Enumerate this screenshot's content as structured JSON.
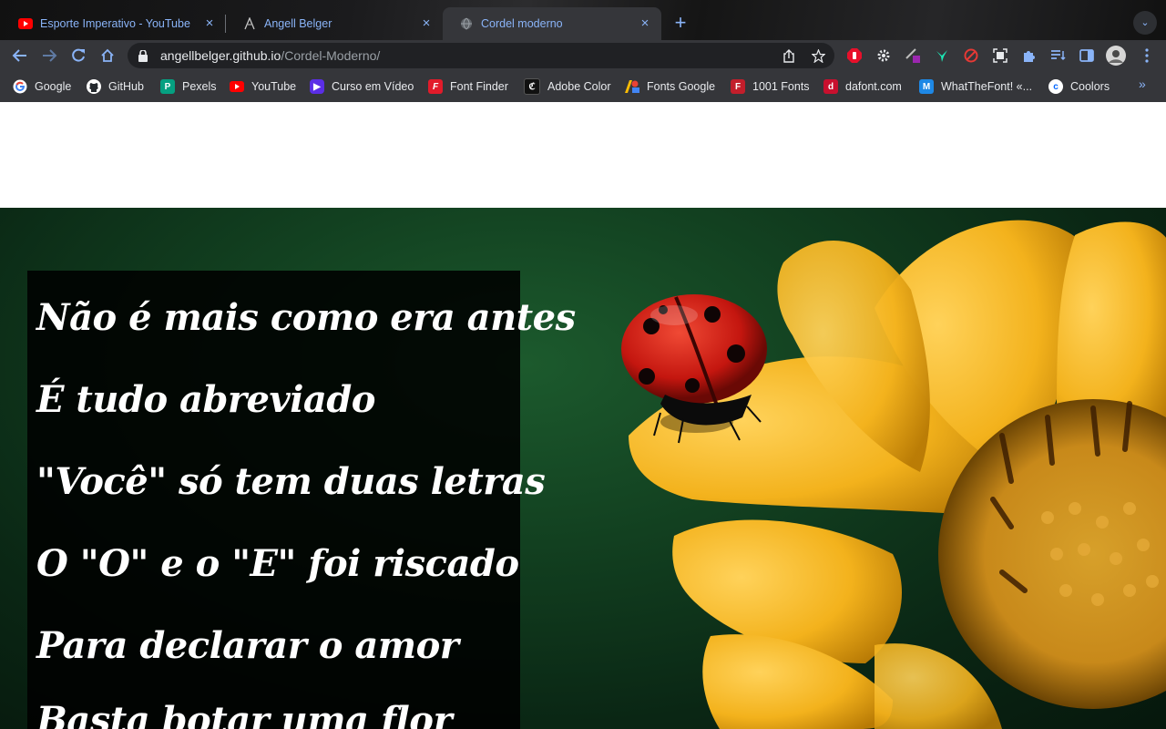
{
  "tabs": [
    {
      "title": "Esporte Imperativo - YouTube",
      "favicon": "youtube-icon"
    },
    {
      "title": "Angell Belger",
      "favicon": "github-pages-icon"
    },
    {
      "title": "Cordel moderno",
      "favicon": "globe-icon"
    }
  ],
  "close_glyph": "×",
  "new_tab_glyph": "+",
  "tab_search_glyph": "⌄",
  "omnibox": {
    "host": "angellbelger.github.io",
    "path": "/Cordel-Moderno/"
  },
  "bookmarks": [
    {
      "label": "Google",
      "icon": "google-icon",
      "color": "#ffffff"
    },
    {
      "label": "GitHub",
      "icon": "github-icon",
      "color": "#ffffff"
    },
    {
      "label": "Pexels",
      "icon": "pexels-icon",
      "color": "#05a081"
    },
    {
      "label": "YouTube",
      "icon": "youtube-icon",
      "color": "#ff0000"
    },
    {
      "label": "Curso em Vídeo",
      "icon": "curso-em-video-icon",
      "color": "#5b2ee6"
    },
    {
      "label": "Font Finder",
      "icon": "font-finder-icon",
      "color": "#e21b2a"
    },
    {
      "label": "Adobe Color",
      "icon": "adobe-color-icon",
      "color": "#111111"
    },
    {
      "label": "Fonts Google",
      "icon": "fonts-google-icon",
      "color": "#4285f4"
    },
    {
      "label": "1001 Fonts",
      "icon": "1001-fonts-icon",
      "color": "#c21e2b"
    },
    {
      "label": "dafont.com",
      "icon": "dafont-icon",
      "color": "#c8102e"
    },
    {
      "label": "WhatTheFont! «...",
      "icon": "whatthefont-icon",
      "color": "#1e88e5"
    },
    {
      "label": "Coolors",
      "icon": "coolors-icon",
      "color": "#0066ff"
    }
  ],
  "bookmarks_more_glyph": "»",
  "poem": {
    "lines": [
      "Não é mais como era antes",
      "É tudo abreviado",
      "\"Você\" só tem duas letras",
      "O \"O\" e o \"E\" foi riscado",
      "Para declarar o amor",
      "Basta botar uma flor"
    ]
  },
  "colors": {
    "accent": "#8ab4f8",
    "petal": "#f3b21c",
    "ladybug": "#c4160f",
    "leaf_bg": "#124020"
  }
}
